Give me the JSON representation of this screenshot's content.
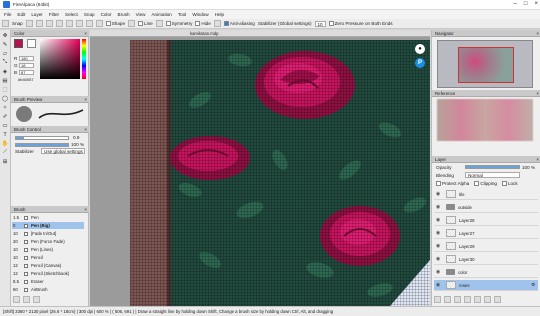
{
  "window": {
    "title": "FireAlpaca (64bit)"
  },
  "menu": [
    "File",
    "Edit",
    "Layer",
    "Filter",
    "Select",
    "Snap",
    "Color",
    "Brush",
    "View",
    "Animation",
    "Tool",
    "Window",
    "Help"
  ],
  "toolbar": {
    "snap_label": "Snap",
    "shape_label": "Shape",
    "line_label": "Line",
    "symmetry_label": "Symmetry",
    "hide_label": "Hide",
    "antialias_label": "Anti-aliasing",
    "stabilizer_label": "Stabilizer (Global settings)",
    "stabilizer_value": "10",
    "zero_pressure_label": "Zero Pressure on Both Ends"
  },
  "color_panel": {
    "title": "Color",
    "fg_color": "#b3124e",
    "bg_color": "#ffffff",
    "r": "180",
    "g": "18",
    "b": "87",
    "hex": "#b40057"
  },
  "brush_preview": {
    "title": "Brush Preview"
  },
  "brush_control": {
    "title": "Brush Control",
    "size_value": "0.9",
    "size_fraction": 0.15,
    "opacity_value": "100 %",
    "opacity_fraction": 1.0,
    "stabilizer_label": "Stabilizer",
    "stabilizer_value": "Use global settings"
  },
  "brush_panel": {
    "title": "Brush",
    "items": [
      {
        "size": "1.5",
        "name": "Pen"
      },
      {
        "size": "0",
        "name": "Pen (Big)"
      },
      {
        "size": "10",
        "name": "[Fade In/Out]"
      },
      {
        "size": "20",
        "name": "Pen (Force Fade)"
      },
      {
        "size": "10",
        "name": "Pen (Lines)"
      },
      {
        "size": "10",
        "name": "Pencil"
      },
      {
        "size": "12",
        "name": "Pencil (Canvas)"
      },
      {
        "size": "12",
        "name": "Pencil (Sketchbook)"
      },
      {
        "size": "8.5",
        "name": "Eraser"
      },
      {
        "size": "50",
        "name": "AirBrush"
      }
    ]
  },
  "canvas": {
    "doc_tab": "kamikotan.mdp"
  },
  "navigator": {
    "title": "Navigator"
  },
  "reference": {
    "title": "Reference"
  },
  "layer_panel": {
    "title": "Layer",
    "opacity_label": "Opacity",
    "opacity_value": "100 %",
    "opacity_fraction": 1.0,
    "blending_label": "Blending",
    "blending_value": "Normal",
    "protect_alpha_label": "Protect Alpha",
    "clipping_label": "Clipping",
    "lock_label": "Lock",
    "layers": [
      {
        "name": "tile",
        "type": "layer"
      },
      {
        "name": "outside",
        "type": "folder"
      },
      {
        "name": "Layer28",
        "type": "layer"
      },
      {
        "name": "Layer27",
        "type": "layer"
      },
      {
        "name": "Layer29",
        "type": "layer"
      },
      {
        "name": "Layer30",
        "type": "layer"
      },
      {
        "name": "color",
        "type": "folder"
      },
      {
        "name": "roses",
        "type": "layer"
      }
    ]
  },
  "status": {
    "dims": "[Shift]  3360 * 2130 pixel",
    "size_cm": "(26.6 * 18cm)",
    "dpi": "300 dpi",
    "zoom": "600 %",
    "coords": "( 506, 691 )",
    "hint": "Draw a straight line by holding down Shift, Change a brush size by holding down Ctrl, Alt, and dragging"
  }
}
